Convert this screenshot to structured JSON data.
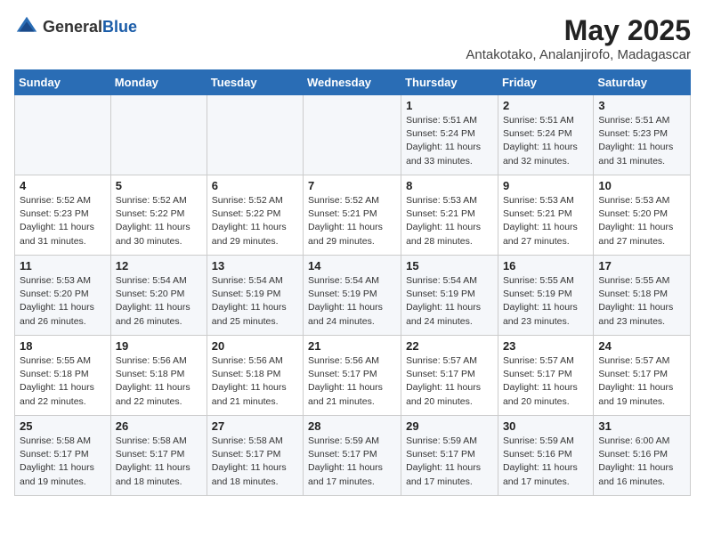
{
  "header": {
    "logo_general": "General",
    "logo_blue": "Blue",
    "month_year": "May 2025",
    "location": "Antakotako, Analanjirofo, Madagascar"
  },
  "days_of_week": [
    "Sunday",
    "Monday",
    "Tuesday",
    "Wednesday",
    "Thursday",
    "Friday",
    "Saturday"
  ],
  "weeks": [
    [
      {
        "day": "",
        "info": ""
      },
      {
        "day": "",
        "info": ""
      },
      {
        "day": "",
        "info": ""
      },
      {
        "day": "",
        "info": ""
      },
      {
        "day": "1",
        "info": "Sunrise: 5:51 AM\nSunset: 5:24 PM\nDaylight: 11 hours\nand 33 minutes."
      },
      {
        "day": "2",
        "info": "Sunrise: 5:51 AM\nSunset: 5:24 PM\nDaylight: 11 hours\nand 32 minutes."
      },
      {
        "day": "3",
        "info": "Sunrise: 5:51 AM\nSunset: 5:23 PM\nDaylight: 11 hours\nand 31 minutes."
      }
    ],
    [
      {
        "day": "4",
        "info": "Sunrise: 5:52 AM\nSunset: 5:23 PM\nDaylight: 11 hours\nand 31 minutes."
      },
      {
        "day": "5",
        "info": "Sunrise: 5:52 AM\nSunset: 5:22 PM\nDaylight: 11 hours\nand 30 minutes."
      },
      {
        "day": "6",
        "info": "Sunrise: 5:52 AM\nSunset: 5:22 PM\nDaylight: 11 hours\nand 29 minutes."
      },
      {
        "day": "7",
        "info": "Sunrise: 5:52 AM\nSunset: 5:21 PM\nDaylight: 11 hours\nand 29 minutes."
      },
      {
        "day": "8",
        "info": "Sunrise: 5:53 AM\nSunset: 5:21 PM\nDaylight: 11 hours\nand 28 minutes."
      },
      {
        "day": "9",
        "info": "Sunrise: 5:53 AM\nSunset: 5:21 PM\nDaylight: 11 hours\nand 27 minutes."
      },
      {
        "day": "10",
        "info": "Sunrise: 5:53 AM\nSunset: 5:20 PM\nDaylight: 11 hours\nand 27 minutes."
      }
    ],
    [
      {
        "day": "11",
        "info": "Sunrise: 5:53 AM\nSunset: 5:20 PM\nDaylight: 11 hours\nand 26 minutes."
      },
      {
        "day": "12",
        "info": "Sunrise: 5:54 AM\nSunset: 5:20 PM\nDaylight: 11 hours\nand 26 minutes."
      },
      {
        "day": "13",
        "info": "Sunrise: 5:54 AM\nSunset: 5:19 PM\nDaylight: 11 hours\nand 25 minutes."
      },
      {
        "day": "14",
        "info": "Sunrise: 5:54 AM\nSunset: 5:19 PM\nDaylight: 11 hours\nand 24 minutes."
      },
      {
        "day": "15",
        "info": "Sunrise: 5:54 AM\nSunset: 5:19 PM\nDaylight: 11 hours\nand 24 minutes."
      },
      {
        "day": "16",
        "info": "Sunrise: 5:55 AM\nSunset: 5:19 PM\nDaylight: 11 hours\nand 23 minutes."
      },
      {
        "day": "17",
        "info": "Sunrise: 5:55 AM\nSunset: 5:18 PM\nDaylight: 11 hours\nand 23 minutes."
      }
    ],
    [
      {
        "day": "18",
        "info": "Sunrise: 5:55 AM\nSunset: 5:18 PM\nDaylight: 11 hours\nand 22 minutes."
      },
      {
        "day": "19",
        "info": "Sunrise: 5:56 AM\nSunset: 5:18 PM\nDaylight: 11 hours\nand 22 minutes."
      },
      {
        "day": "20",
        "info": "Sunrise: 5:56 AM\nSunset: 5:18 PM\nDaylight: 11 hours\nand 21 minutes."
      },
      {
        "day": "21",
        "info": "Sunrise: 5:56 AM\nSunset: 5:17 PM\nDaylight: 11 hours\nand 21 minutes."
      },
      {
        "day": "22",
        "info": "Sunrise: 5:57 AM\nSunset: 5:17 PM\nDaylight: 11 hours\nand 20 minutes."
      },
      {
        "day": "23",
        "info": "Sunrise: 5:57 AM\nSunset: 5:17 PM\nDaylight: 11 hours\nand 20 minutes."
      },
      {
        "day": "24",
        "info": "Sunrise: 5:57 AM\nSunset: 5:17 PM\nDaylight: 11 hours\nand 19 minutes."
      }
    ],
    [
      {
        "day": "25",
        "info": "Sunrise: 5:58 AM\nSunset: 5:17 PM\nDaylight: 11 hours\nand 19 minutes."
      },
      {
        "day": "26",
        "info": "Sunrise: 5:58 AM\nSunset: 5:17 PM\nDaylight: 11 hours\nand 18 minutes."
      },
      {
        "day": "27",
        "info": "Sunrise: 5:58 AM\nSunset: 5:17 PM\nDaylight: 11 hours\nand 18 minutes."
      },
      {
        "day": "28",
        "info": "Sunrise: 5:59 AM\nSunset: 5:17 PM\nDaylight: 11 hours\nand 17 minutes."
      },
      {
        "day": "29",
        "info": "Sunrise: 5:59 AM\nSunset: 5:17 PM\nDaylight: 11 hours\nand 17 minutes."
      },
      {
        "day": "30",
        "info": "Sunrise: 5:59 AM\nSunset: 5:16 PM\nDaylight: 11 hours\nand 17 minutes."
      },
      {
        "day": "31",
        "info": "Sunrise: 6:00 AM\nSunset: 5:16 PM\nDaylight: 11 hours\nand 16 minutes."
      }
    ]
  ]
}
